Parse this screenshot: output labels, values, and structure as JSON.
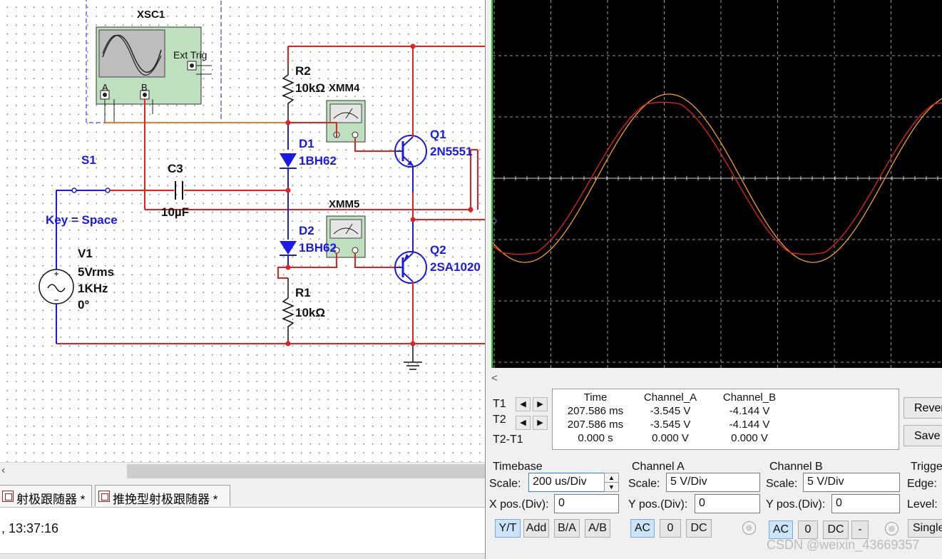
{
  "schematic": {
    "scope_label": "XSC1",
    "ext_trig": "Ext Trig",
    "pin_a": "A",
    "pin_b": "B",
    "r2": {
      "name": "R2",
      "value": "10kΩ"
    },
    "xmm4": "XMM4",
    "xmm5": "XMM5",
    "d1": {
      "name": "D1",
      "part": "1BH62"
    },
    "d2": {
      "name": "D2",
      "part": "1BH62"
    },
    "q1": {
      "name": "Q1",
      "part": "2N5551"
    },
    "q2": {
      "name": "Q2",
      "part": "2SA1020"
    },
    "s1": {
      "name": "S1",
      "key": "Key = Space"
    },
    "c3": {
      "name": "C3",
      "value": "10µF"
    },
    "v1": {
      "name": "V1",
      "amp": "5Vrms",
      "freq": "1KHz",
      "phase": "0°"
    },
    "r1": {
      "name": "R1",
      "value": "10kΩ"
    }
  },
  "tabs": [
    {
      "label": "射极跟随器 *"
    },
    {
      "label": "推挽型射极跟随器 *"
    }
  ],
  "status": {
    "time": ", 13:37:16"
  },
  "oscilloscope": {
    "scroll_arrow": "<",
    "t1_label": "T1",
    "t2_label": "T2",
    "t2t1_label": "T2-T1",
    "columns": [
      "Time",
      "Channel_A",
      "Channel_B"
    ],
    "rows": [
      [
        "207.586 ms",
        "-3.545 V",
        "-4.144 V"
      ],
      [
        "207.586 ms",
        "-3.545 V",
        "-4.144 V"
      ],
      [
        "0.000 s",
        "0.000 V",
        "0.000 V"
      ]
    ],
    "reverse_label": "Reverse",
    "save_label": "Save",
    "timebase": {
      "title": "Timebase",
      "scale_label": "Scale:",
      "scale_value": "200 us/Div",
      "xpos_label": "X pos.(Div):",
      "xpos_value": "0",
      "buttons": [
        "Y/T",
        "Add",
        "B/A",
        "A/B"
      ]
    },
    "channel_a": {
      "title": "Channel A",
      "scale_label": "Scale:",
      "scale_value": "5  V/Div",
      "ypos_label": "Y pos.(Div):",
      "ypos_value": "0",
      "buttons": [
        "AC",
        "0",
        "DC"
      ]
    },
    "channel_b": {
      "title": "Channel B",
      "scale_label": "Scale:",
      "scale_value": "5  V/Div",
      "ypos_label": "Y pos.(Div):",
      "ypos_value": "0",
      "buttons": [
        "AC",
        "0",
        "DC",
        "-"
      ]
    },
    "trigger": {
      "title": "Trigger",
      "edge_label": "Edge:",
      "level_label": "Level:",
      "single_label": "Single"
    },
    "colors": {
      "screen_bg": "#000000",
      "grid": "#9a9a9a",
      "trace_a": "#e62020",
      "trace_b": "#f0a020",
      "left_marker": "#1fcf1f"
    }
  },
  "watermark": "CSDN @weixin_43669357"
}
